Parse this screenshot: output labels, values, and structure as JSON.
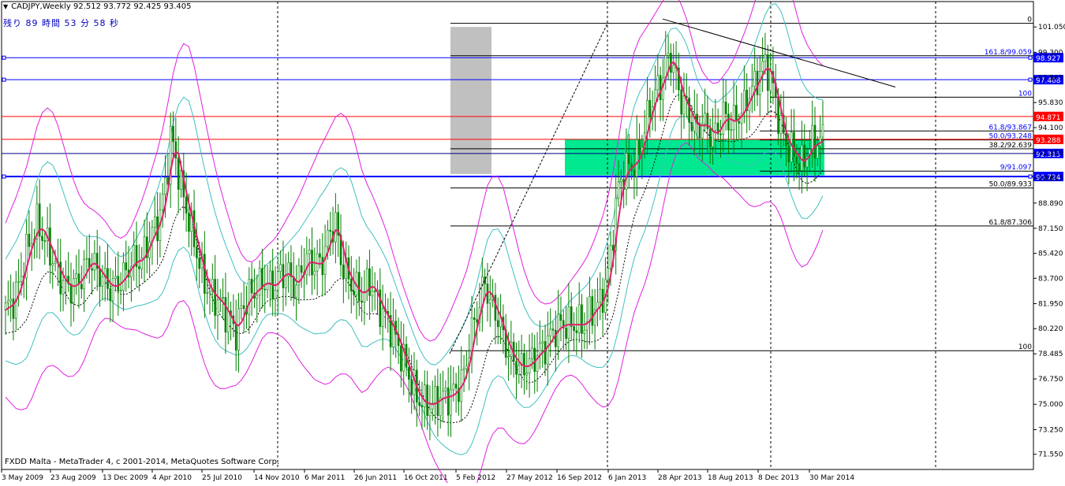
{
  "header": {
    "symbol_line": "CADJPY,Weekly  92.512 93.772 92.425 93.405",
    "timer": "残り 89 時間 53 分 58 秒"
  },
  "footer": {
    "copyright": "FXDD Malta - MetaTrader 4, c 2001-2014, MetaQuotes Software Corp."
  },
  "colors": {
    "background": "#ffffff",
    "candle": "#008000",
    "ma": "#e0206e",
    "bollinger_outer": "#e020e0",
    "bollinger_inner": "#40c0c0",
    "fib": "#000000",
    "horizontal_blue": "#0000ff",
    "horizontal_red": "#ff0000",
    "zone": "#00e890",
    "gray_zone": "#c0c0c0"
  },
  "chart_data": {
    "type": "candlestick",
    "symbol": "CADJPY",
    "timeframe": "Weekly",
    "ylim": [
      70.5,
      102.8
    ],
    "y_ticks": [
      "101.050",
      "99.300",
      "97.565",
      "95.830",
      "94.100",
      "92.350",
      "90.615",
      "88.890",
      "87.150",
      "85.420",
      "83.700",
      "81.950",
      "80.220",
      "78.485",
      "76.750",
      "75.000",
      "73.250",
      "71.550"
    ],
    "x_ticks": [
      "3 May 2009",
      "23 Aug 2009",
      "13 Dec 2009",
      "4 Apr 2010",
      "25 Jul 2010",
      "14 Nov 2010",
      "6 Mar 2011",
      "26 Jun 2011",
      "16 Oct 2011",
      "5 Feb 2012",
      "27 May 2012",
      "16 Sep 2012",
      "6 Jan 2013",
      "28 Apr 2013",
      "18 Aug 2013",
      "8 Dec 2013",
      "30 Mar 2014"
    ],
    "x_vgrid_ticks": [
      8,
      16
    ],
    "close_path": [
      [
        0,
        81.5
      ],
      [
        4,
        82.5
      ],
      [
        8,
        85.5
      ],
      [
        12,
        87.5
      ],
      [
        16,
        86.0
      ],
      [
        20,
        84.0
      ],
      [
        24,
        83.0
      ],
      [
        28,
        83.5
      ],
      [
        32,
        85.0
      ],
      [
        36,
        84.0
      ],
      [
        40,
        83.0
      ],
      [
        44,
        83.5
      ],
      [
        48,
        84.8
      ],
      [
        52,
        85.0
      ],
      [
        55,
        86.5
      ],
      [
        58,
        87.5
      ],
      [
        60,
        89.0
      ],
      [
        62,
        91.5
      ],
      [
        63,
        93.5
      ],
      [
        65,
        92.0
      ],
      [
        67,
        90.0
      ],
      [
        69,
        88.5
      ],
      [
        71,
        87.0
      ],
      [
        73,
        85.5
      ],
      [
        75,
        84.0
      ],
      [
        77,
        83.0
      ],
      [
        79,
        82.5
      ],
      [
        82,
        82.0
      ],
      [
        85,
        81.0
      ],
      [
        88,
        80.0
      ],
      [
        90,
        81.5
      ],
      [
        93,
        82.5
      ],
      [
        96,
        83.0
      ],
      [
        99,
        83.5
      ],
      [
        102,
        83.0
      ],
      [
        105,
        84.0
      ],
      [
        108,
        84.0
      ],
      [
        111,
        83.0
      ],
      [
        113,
        84.5
      ],
      [
        116,
        85.0
      ],
      [
        118,
        84.5
      ],
      [
        121,
        85.0
      ],
      [
        124,
        87.0
      ],
      [
        126,
        87.5
      ],
      [
        128,
        85.0
      ],
      [
        130,
        84.0
      ],
      [
        133,
        83.0
      ],
      [
        136,
        82.5
      ],
      [
        139,
        83.5
      ],
      [
        142,
        82.0
      ],
      [
        145,
        81.0
      ],
      [
        148,
        80.0
      ],
      [
        151,
        78.5
      ],
      [
        154,
        77.0
      ],
      [
        157,
        75.5
      ],
      [
        160,
        75.0
      ],
      [
        163,
        75.0
      ],
      [
        166,
        75.5
      ],
      [
        169,
        75.5
      ],
      [
        172,
        76.0
      ],
      [
        175,
        77.0
      ],
      [
        178,
        80.0
      ],
      [
        181,
        82.0
      ],
      [
        183,
        83.5
      ],
      [
        185,
        82.0
      ],
      [
        188,
        81.0
      ],
      [
        191,
        79.0
      ],
      [
        194,
        78.0
      ],
      [
        197,
        77.5
      ],
      [
        200,
        77.8
      ],
      [
        203,
        78.5
      ],
      [
        206,
        79.0
      ],
      [
        209,
        80.0
      ],
      [
        212,
        80.5
      ],
      [
        215,
        80.5
      ],
      [
        218,
        80.5
      ],
      [
        221,
        80.5
      ],
      [
        224,
        81.5
      ],
      [
        227,
        82.0
      ],
      [
        230,
        84.0
      ],
      [
        232,
        87.0
      ],
      [
        234,
        90.0
      ],
      [
        236,
        91.0
      ],
      [
        238,
        91.5
      ],
      [
        240,
        91.5
      ],
      [
        242,
        92.5
      ],
      [
        244,
        94.0
      ],
      [
        246,
        95.5
      ],
      [
        248,
        96.5
      ],
      [
        250,
        97.0
      ],
      [
        252,
        98.5
      ],
      [
        254,
        99.0
      ],
      [
        256,
        97.5
      ],
      [
        258,
        96.0
      ],
      [
        260,
        95.5
      ],
      [
        262,
        94.5
      ],
      [
        264,
        94.0
      ],
      [
        266,
        94.5
      ],
      [
        268,
        94.0
      ],
      [
        270,
        93.5
      ],
      [
        272,
        94.0
      ],
      [
        274,
        95.0
      ],
      [
        276,
        94.5
      ],
      [
        278,
        94.5
      ],
      [
        280,
        95.0
      ],
      [
        282,
        95.5
      ],
      [
        284,
        96.5
      ],
      [
        286,
        97.0
      ],
      [
        288,
        98.0
      ],
      [
        290,
        98.5
      ],
      [
        292,
        97.5
      ],
      [
        294,
        96.0
      ],
      [
        296,
        94.0
      ],
      [
        298,
        93.0
      ],
      [
        300,
        92.5
      ],
      [
        302,
        92.0
      ],
      [
        304,
        91.5
      ],
      [
        306,
        92.5
      ],
      [
        308,
        93.0
      ],
      [
        310,
        93.0
      ],
      [
        312,
        93.4
      ]
    ],
    "horizontal_lines": [
      {
        "value": 98.927,
        "label": "98.927",
        "color": "#0000ff",
        "tag_color": "#0000ff"
      },
      {
        "value": 97.408,
        "label": "97.408",
        "color": "#0000ff",
        "tag_color": "#0000ff"
      },
      {
        "value": 94.871,
        "label": "94.871",
        "color": "#ff0000",
        "tag_color": "#ff0000"
      },
      {
        "value": 93.288,
        "label": "93.288",
        "color": "#ff0000",
        "tag_color": "#ff0000"
      },
      {
        "value": 92.315,
        "label": "92.315",
        "color": "#000080",
        "tag_color": "#0000ff"
      },
      {
        "value": 90.724,
        "label": "90.724",
        "color": "#0000ff",
        "tag_color": "#0000ff"
      }
    ],
    "fib_labels": [
      {
        "text": "0",
        "value": 101.3
      },
      {
        "text": "161.8/99.059",
        "value": 99.059
      },
      {
        "text": "100",
        "value": 96.2
      },
      {
        "text": "61.8/93.867",
        "value": 93.867
      },
      {
        "text": "50.0/93.248",
        "value": 93.248
      },
      {
        "text": "38.2/92.639",
        "value": 92.639
      },
      {
        "text": "9/91.097",
        "value": 91.097
      },
      {
        "text": "50.0/89.933",
        "value": 89.933
      },
      {
        "text": "61.8/87.306",
        "value": 87.306
      },
      {
        "text": "100",
        "value": 78.7
      }
    ],
    "zones": [
      {
        "name": "green-zone",
        "y_top": 93.3,
        "y_bottom": 90.8,
        "color": "#00e890"
      },
      {
        "name": "gray-zone",
        "y_top": 101.05,
        "y_bottom": 90.9,
        "color": "#c0c0c0"
      }
    ]
  }
}
